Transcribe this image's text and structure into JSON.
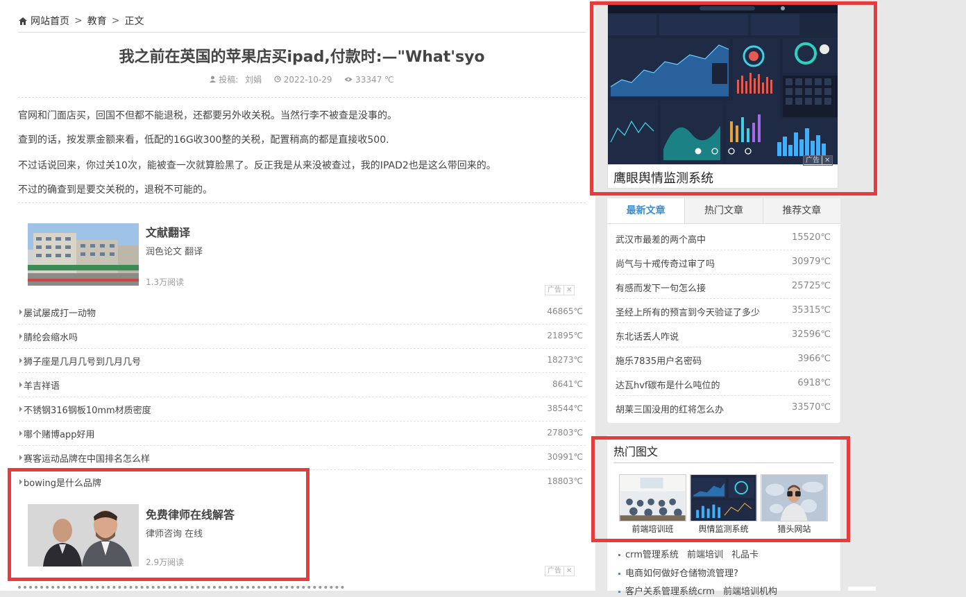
{
  "breadcrumb": {
    "home": "网站首页",
    "sep": ">",
    "category": "教育",
    "current": "正文"
  },
  "article": {
    "title": "我之前在英国的苹果店买ipad,付款时:—\"What'syo",
    "author_label": "投稿:",
    "author": "刘娟",
    "date": "2022-10-29",
    "views": "33347 ℃",
    "paragraphs": [
      "官网和门面店买，回国不但都不能退税，还都要另外收关税。当然行李不被查是没事的。",
      "查到的话，按发票金额来看，低配的16G收300整的关税，配置稍高的都是直接收500.",
      "不过话说回来，你过关10次，能被查一次就算脸黑了。反正我是从来没被查过，我的IPAD2也是这么带回来的。",
      "不过的确查到是要交关税的，退税不可能的。"
    ]
  },
  "ad1": {
    "title": "文献翻译",
    "desc": "润色论文 翻译",
    "reads": "1.3万阅读",
    "tag": "广告",
    "close": "✕"
  },
  "ad2": {
    "title": "免费律师在线解答",
    "desc": "律师咨询 在线",
    "reads": "2.9万阅读",
    "tag": "广告",
    "close": "✕"
  },
  "related": [
    {
      "text": "屡试屡成打一动物",
      "views": "46865℃"
    },
    {
      "text": "腈纶会缩水吗",
      "views": "21895℃"
    },
    {
      "text": "狮子座是几月几号到几月几号",
      "views": "18273℃"
    },
    {
      "text": "羊吉祥语",
      "views": "8641℃"
    },
    {
      "text": "不锈钢316钢板10mm材质密度",
      "views": "38544℃"
    },
    {
      "text": "哪个赌博app好用",
      "views": "27803℃"
    },
    {
      "text": "赛客运动品牌在中国排名怎么样",
      "views": "30991℃"
    },
    {
      "text": "bowing是什么品牌",
      "views": "18803℃"
    }
  ],
  "sidebar": {
    "banner": {
      "caption": "鹰眼舆情监测系统",
      "tag": "广告",
      "close": "✕",
      "dots": 4
    },
    "tabs": [
      "最新文章",
      "热门文章",
      "推荐文章"
    ],
    "latest": [
      {
        "text": "武汉市最差的两个高中",
        "views": "15520℃"
      },
      {
        "text": "尚气与十戒传奇过审了吗",
        "views": "30979℃"
      },
      {
        "text": "有感而发下一句怎么接",
        "views": "25725℃"
      },
      {
        "text": "圣经上所有的预言到今天验证了多少",
        "views": "35315℃"
      },
      {
        "text": "东北话丢人咋说",
        "views": "32596℃"
      },
      {
        "text": "施乐7835用户名密码",
        "views": "3966℃"
      },
      {
        "text": "达瓦hvf碳布是什么吨位的",
        "views": "6918℃"
      },
      {
        "text": "胡莱三国没用的红将怎么办",
        "views": "33570℃"
      }
    ],
    "hot_title": "热门图文",
    "thumbs": [
      "前端培训班",
      "舆情监测系统",
      "猎头网站"
    ],
    "links": [
      [
        "crm管理系统",
        "前端培训",
        "礼品卡"
      ],
      [
        "电商如何做好仓储物流管理?"
      ],
      [
        "客户关系管理系统crm",
        "前端培训机构"
      ]
    ]
  },
  "colors": {
    "accent": "#3b8ed8",
    "highlight": "#e83b3b",
    "dashboard_bg": "#1c2740"
  }
}
